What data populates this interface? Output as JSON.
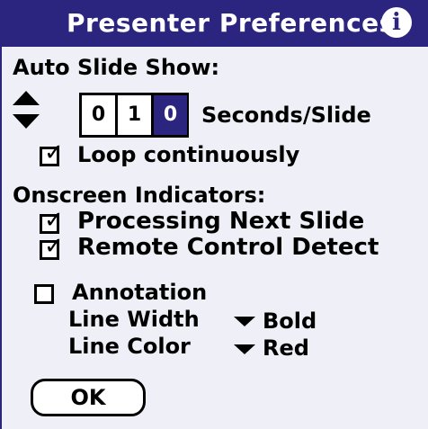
{
  "dialog": {
    "title": "Presenter Preferences",
    "info_icon": "info-icon"
  },
  "auto_slide_show": {
    "heading": "Auto Slide Show:",
    "digits": [
      "0",
      "1",
      "0"
    ],
    "selected_digit_index": 2,
    "unit_label": "Seconds/Slide",
    "loop_label": "Loop continuously",
    "loop_checked": true
  },
  "onscreen_indicators": {
    "heading": "Onscreen Indicators:",
    "items": [
      {
        "label": "Processing Next Slide",
        "checked": true
      },
      {
        "label": "Remote Control Detect",
        "checked": true
      }
    ]
  },
  "annotation": {
    "label": "Annotation",
    "checked": false,
    "line_width_label": "Line Width",
    "line_width_value": "Bold",
    "line_color_label": "Line Color",
    "line_color_value": "Red"
  },
  "buttons": {
    "ok_label": "OK"
  },
  "colors": {
    "title_bar": "#2b2580",
    "background": "#efeff7",
    "selected_digit": "#2b2580"
  }
}
